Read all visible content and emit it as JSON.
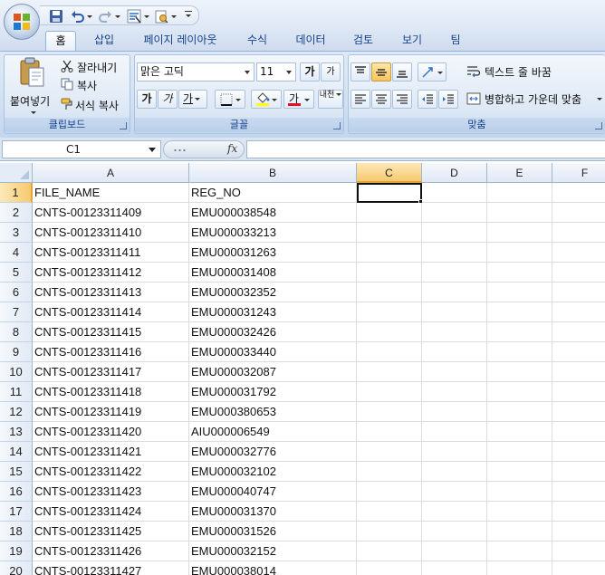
{
  "quick_access": {
    "icons": [
      "office-logo-icon",
      "save-icon",
      "undo-icon",
      "redo-icon",
      "sort-filter-icon",
      "print-preview-icon",
      "customize-toolbar-icon"
    ]
  },
  "tabs": [
    {
      "label": "홈",
      "active": true
    },
    {
      "label": "삽입"
    },
    {
      "label": "페이지 레이아웃"
    },
    {
      "label": "수식"
    },
    {
      "label": "데이터"
    },
    {
      "label": "검토"
    },
    {
      "label": "보기"
    },
    {
      "label": "팀"
    }
  ],
  "ribbon": {
    "clipboard": {
      "paste_label": "붙여넣기",
      "cut_label": "잘라내기",
      "copy_label": "복사",
      "format_painter_label": "서식 복사",
      "group_label": "클립보드"
    },
    "font": {
      "font_name": "맑은 고딕",
      "font_size": "11",
      "grow_label": "가",
      "shrink_label": "가",
      "bold_label": "가",
      "italic_label": "가",
      "underline_label": "가",
      "phonetic_label": "내천",
      "font_color": "#e81123",
      "fill_color": "#ffff00",
      "group_label": "글꼴"
    },
    "alignment": {
      "wrap_text_label": "텍스트 줄 바꿈",
      "merge_center_label": "병합하고 가운데 맞춤",
      "group_label": "맞춤"
    }
  },
  "formula_bar": {
    "name_box": "C1",
    "fx_label": "fx",
    "formula": ""
  },
  "sheet": {
    "columns": [
      "A",
      "B",
      "C",
      "D",
      "E",
      "F"
    ],
    "selected_column": "C",
    "selected_row": "1",
    "active_cell": "C1",
    "rows": [
      {
        "num": "1",
        "a": "FILE_NAME",
        "b": "REG_NO"
      },
      {
        "num": "2",
        "a": "CNTS-00123311409",
        "b": "EMU000038548"
      },
      {
        "num": "3",
        "a": "CNTS-00123311410",
        "b": "EMU000033213"
      },
      {
        "num": "4",
        "a": "CNTS-00123311411",
        "b": "EMU000031263"
      },
      {
        "num": "5",
        "a": "CNTS-00123311412",
        "b": "EMU000031408"
      },
      {
        "num": "6",
        "a": "CNTS-00123311413",
        "b": "EMU000032352"
      },
      {
        "num": "7",
        "a": "CNTS-00123311414",
        "b": "EMU000031243"
      },
      {
        "num": "8",
        "a": "CNTS-00123311415",
        "b": "EMU000032426"
      },
      {
        "num": "9",
        "a": "CNTS-00123311416",
        "b": "EMU000033440"
      },
      {
        "num": "10",
        "a": "CNTS-00123311417",
        "b": "EMU000032087"
      },
      {
        "num": "11",
        "a": "CNTS-00123311418",
        "b": "EMU000031792"
      },
      {
        "num": "12",
        "a": "CNTS-00123311419",
        "b": "EMU000380653"
      },
      {
        "num": "13",
        "a": "CNTS-00123311420",
        "b": "AIU000006549"
      },
      {
        "num": "14",
        "a": "CNTS-00123311421",
        "b": "EMU000032776"
      },
      {
        "num": "15",
        "a": "CNTS-00123311422",
        "b": "EMU000032102"
      },
      {
        "num": "16",
        "a": "CNTS-00123311423",
        "b": "EMU000040747"
      },
      {
        "num": "17",
        "a": "CNTS-00123311424",
        "b": "EMU000031370"
      },
      {
        "num": "18",
        "a": "CNTS-00123311425",
        "b": "EMU000031526"
      },
      {
        "num": "19",
        "a": "CNTS-00123311426",
        "b": "EMU000032152"
      },
      {
        "num": "20",
        "a": "CNTS-00123311427",
        "b": "EMU000038014"
      }
    ]
  }
}
